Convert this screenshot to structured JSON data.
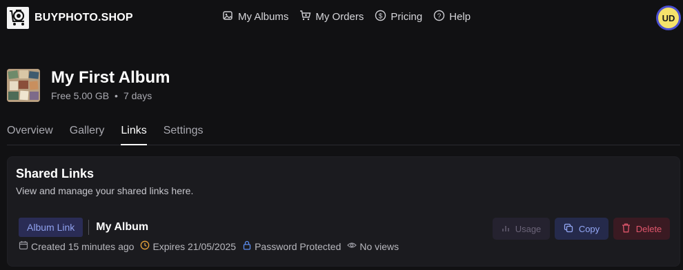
{
  "brand": {
    "name": "BUYPHOTO.SHOP",
    "logo_icon": "camera-cart-icon"
  },
  "nav": [
    {
      "label": "My Albums",
      "icon": "albums-icon"
    },
    {
      "label": "My Orders",
      "icon": "cart-icon"
    },
    {
      "label": "Pricing",
      "icon": "dollar-icon"
    },
    {
      "label": "Help",
      "icon": "help-icon"
    }
  ],
  "user": {
    "initials": "UD",
    "avatar_color": "#f5e26b",
    "ring_color": "#4b4fd1"
  },
  "album": {
    "title": "My First Album",
    "storage": "Free 5.00 GB",
    "separator": "•",
    "duration": "7 days"
  },
  "tabs": [
    {
      "label": "Overview",
      "active": false
    },
    {
      "label": "Gallery",
      "active": false
    },
    {
      "label": "Links",
      "active": true
    },
    {
      "label": "Settings",
      "active": false
    }
  ],
  "shared_links": {
    "title": "Shared Links",
    "subtitle": "View and manage your shared links here.",
    "links": [
      {
        "type_badge": "Album Link",
        "name": "My Album",
        "created": "Created 15 minutes ago",
        "expires": "Expires 21/05/2025",
        "protection": "Password Protected",
        "views": "No views",
        "actions": {
          "usage": "Usage",
          "copy": "Copy",
          "delete": "Delete"
        }
      }
    ]
  },
  "colors": {
    "background": "#111113",
    "card": "#1b1b1f",
    "accent_blue": "#94a8f6",
    "danger": "#e0566c",
    "warning": "#e8a33a",
    "lock_blue": "#5b8def"
  }
}
